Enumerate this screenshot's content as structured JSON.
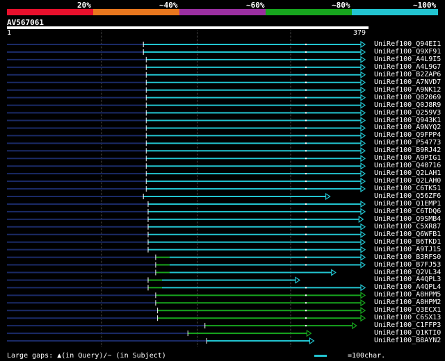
{
  "identity_scale": {
    "labels": [
      "20%",
      "~40%",
      "~60%",
      "~80%",
      "~100%"
    ],
    "colors": [
      "#e8102c",
      "#e8771e",
      "#9b2fa1",
      "#17a51e",
      "#22c4d0"
    ]
  },
  "query": {
    "name": "AV567061",
    "start": "1",
    "end": "379",
    "length": 379
  },
  "hits": [
    {
      "name": "UniRef100_Q94EI1",
      "start": 145,
      "end": 379,
      "color": "cyan"
    },
    {
      "name": "UniRef100_Q9XF91",
      "start": 145,
      "end": 379,
      "color": "cyan"
    },
    {
      "name": "UniRef100_A4L9I5",
      "start": 148,
      "end": 379,
      "color": "cyan"
    },
    {
      "name": "UniRef100_A4L9G7",
      "start": 148,
      "end": 379,
      "color": "cyan"
    },
    {
      "name": "UniRef100_B2ZAP6",
      "start": 148,
      "end": 379,
      "color": "cyan"
    },
    {
      "name": "UniRef100_A7NVD7",
      "start": 148,
      "end": 379,
      "color": "cyan"
    },
    {
      "name": "UniRef100_A9NK12",
      "start": 148,
      "end": 379,
      "color": "cyan"
    },
    {
      "name": "UniRef100_Q02069",
      "start": 148,
      "end": 379,
      "color": "cyan"
    },
    {
      "name": "UniRef100_Q0J8R9",
      "start": 148,
      "end": 379,
      "color": "cyan"
    },
    {
      "name": "UniRef100_Q259V3",
      "start": 148,
      "end": 379,
      "color": "cyan"
    },
    {
      "name": "UniRef100_Q943K1",
      "start": 148,
      "end": 379,
      "color": "cyan"
    },
    {
      "name": "UniRef100_A9NYQ2",
      "start": 148,
      "end": 379,
      "color": "cyan"
    },
    {
      "name": "UniRef100_Q9FPP4",
      "start": 148,
      "end": 379,
      "color": "cyan"
    },
    {
      "name": "UniRef100_P54773",
      "start": 148,
      "end": 379,
      "color": "cyan"
    },
    {
      "name": "UniRef100_B9RJ42",
      "start": 148,
      "end": 379,
      "color": "cyan"
    },
    {
      "name": "UniRef100_A9PIG1",
      "start": 148,
      "end": 379,
      "color": "cyan"
    },
    {
      "name": "UniRef100_Q40716",
      "start": 148,
      "end": 379,
      "color": "cyan"
    },
    {
      "name": "UniRef100_Q2LAH1",
      "start": 148,
      "end": 379,
      "color": "cyan"
    },
    {
      "name": "UniRef100_Q2LAH0",
      "start": 148,
      "end": 379,
      "color": "cyan"
    },
    {
      "name": "UniRef100_C6TK51",
      "start": 148,
      "end": 379,
      "color": "cyan"
    },
    {
      "name": "UniRef100_Q56ZF6",
      "start": 145,
      "end": 342,
      "color": "cyan"
    },
    {
      "name": "UniRef100_Q1EMP1",
      "start": 150,
      "end": 379,
      "color": "cyan"
    },
    {
      "name": "UniRef100_C6TDQ6",
      "start": 150,
      "end": 379,
      "color": "cyan"
    },
    {
      "name": "UniRef100_Q9SMB4",
      "start": 150,
      "end": 377,
      "color": "cyan"
    },
    {
      "name": "UniRef100_C5XR87",
      "start": 150,
      "end": 379,
      "color": "cyan"
    },
    {
      "name": "UniRef100_Q6WFB1",
      "start": 150,
      "end": 379,
      "color": "cyan"
    },
    {
      "name": "UniRef100_B6TKD1",
      "start": 150,
      "end": 379,
      "color": "cyan"
    },
    {
      "name": "UniRef100_A9TJ15",
      "start": 150,
      "end": 379,
      "color": "cyan"
    },
    {
      "name": "UniRef100_B3RFS0",
      "start": 158,
      "end": 379,
      "color": "mixed"
    },
    {
      "name": "UniRef100_B7FJ53",
      "start": 158,
      "end": 379,
      "color": "mixed"
    },
    {
      "name": "UniRef100_Q2VL34",
      "start": 158,
      "end": 348,
      "color": "mixed"
    },
    {
      "name": "UniRef100_A4QPL3",
      "start": 150,
      "end": 310,
      "color": "mixed"
    },
    {
      "name": "UniRef100_A4QPL4",
      "start": 150,
      "end": 379,
      "color": "mixed"
    },
    {
      "name": "UniRef100_A8HPM5",
      "start": 158,
      "end": 379,
      "color": "green"
    },
    {
      "name": "UniRef100_A8HPM2",
      "start": 158,
      "end": 379,
      "color": "green"
    },
    {
      "name": "UniRef100_Q3ECX1",
      "start": 160,
      "end": 379,
      "color": "green"
    },
    {
      "name": "UniRef100_C6SX13",
      "start": 160,
      "end": 379,
      "color": "green"
    },
    {
      "name": "UniRef100_C1FFP3",
      "start": 210,
      "end": 370,
      "color": "green"
    },
    {
      "name": "UniRef100_Q1KTI0",
      "start": 192,
      "end": 322,
      "color": "green"
    },
    {
      "name": "UniRef100_B8AYN2",
      "start": 212,
      "end": 325,
      "color": "cyan"
    }
  ],
  "legend": {
    "text": "Large gaps: ▲(in Query)/~ (in Subject)",
    "scale_text": "=100char."
  }
}
